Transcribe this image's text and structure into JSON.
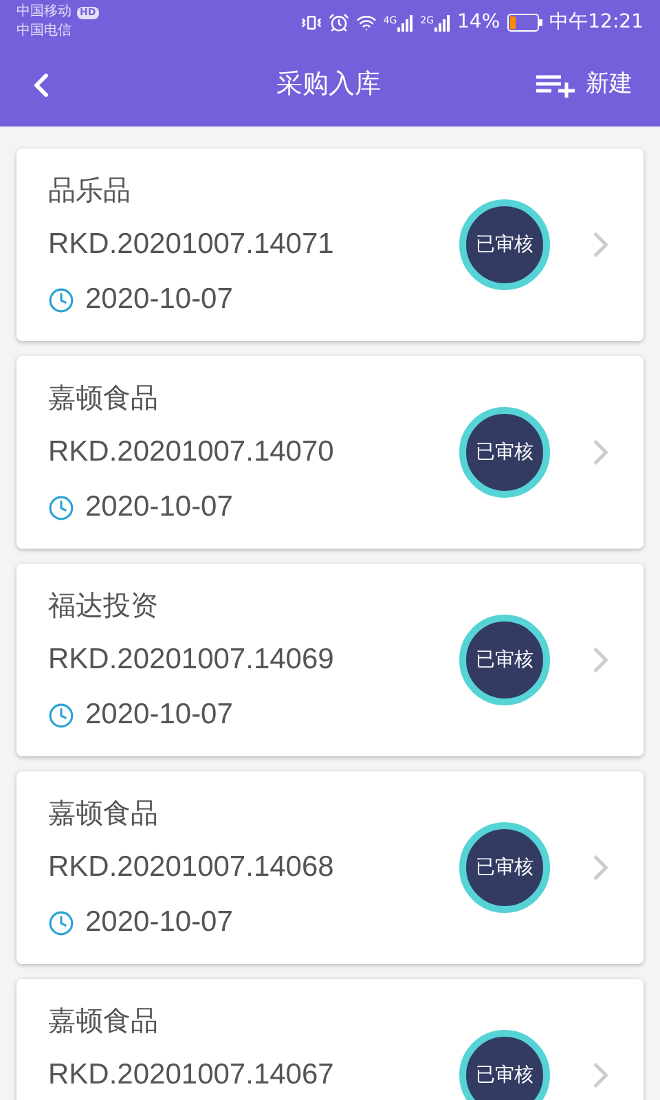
{
  "status_bar": {
    "carrier_1": "中国移动",
    "carrier_1_badge": "HD",
    "carrier_2": "中国电信",
    "network_1": "4G",
    "network_2": "2G",
    "battery": "14%",
    "time": "中午12:21"
  },
  "header": {
    "title": "采购入库",
    "action": "新建"
  },
  "records": [
    {
      "name": "品乐品",
      "number": "RKD.20201007.14071",
      "date": "2020-10-07",
      "status": "已审核"
    },
    {
      "name": "嘉顿食品",
      "number": "RKD.20201007.14070",
      "date": "2020-10-07",
      "status": "已审核"
    },
    {
      "name": "福达投资",
      "number": "RKD.20201007.14069",
      "date": "2020-10-07",
      "status": "已审核"
    },
    {
      "name": "嘉顿食品",
      "number": "RKD.20201007.14068",
      "date": "2020-10-07",
      "status": "已审核"
    },
    {
      "name": "嘉顿食品",
      "number": "RKD.20201007.14067",
      "status": "已审核"
    }
  ]
}
